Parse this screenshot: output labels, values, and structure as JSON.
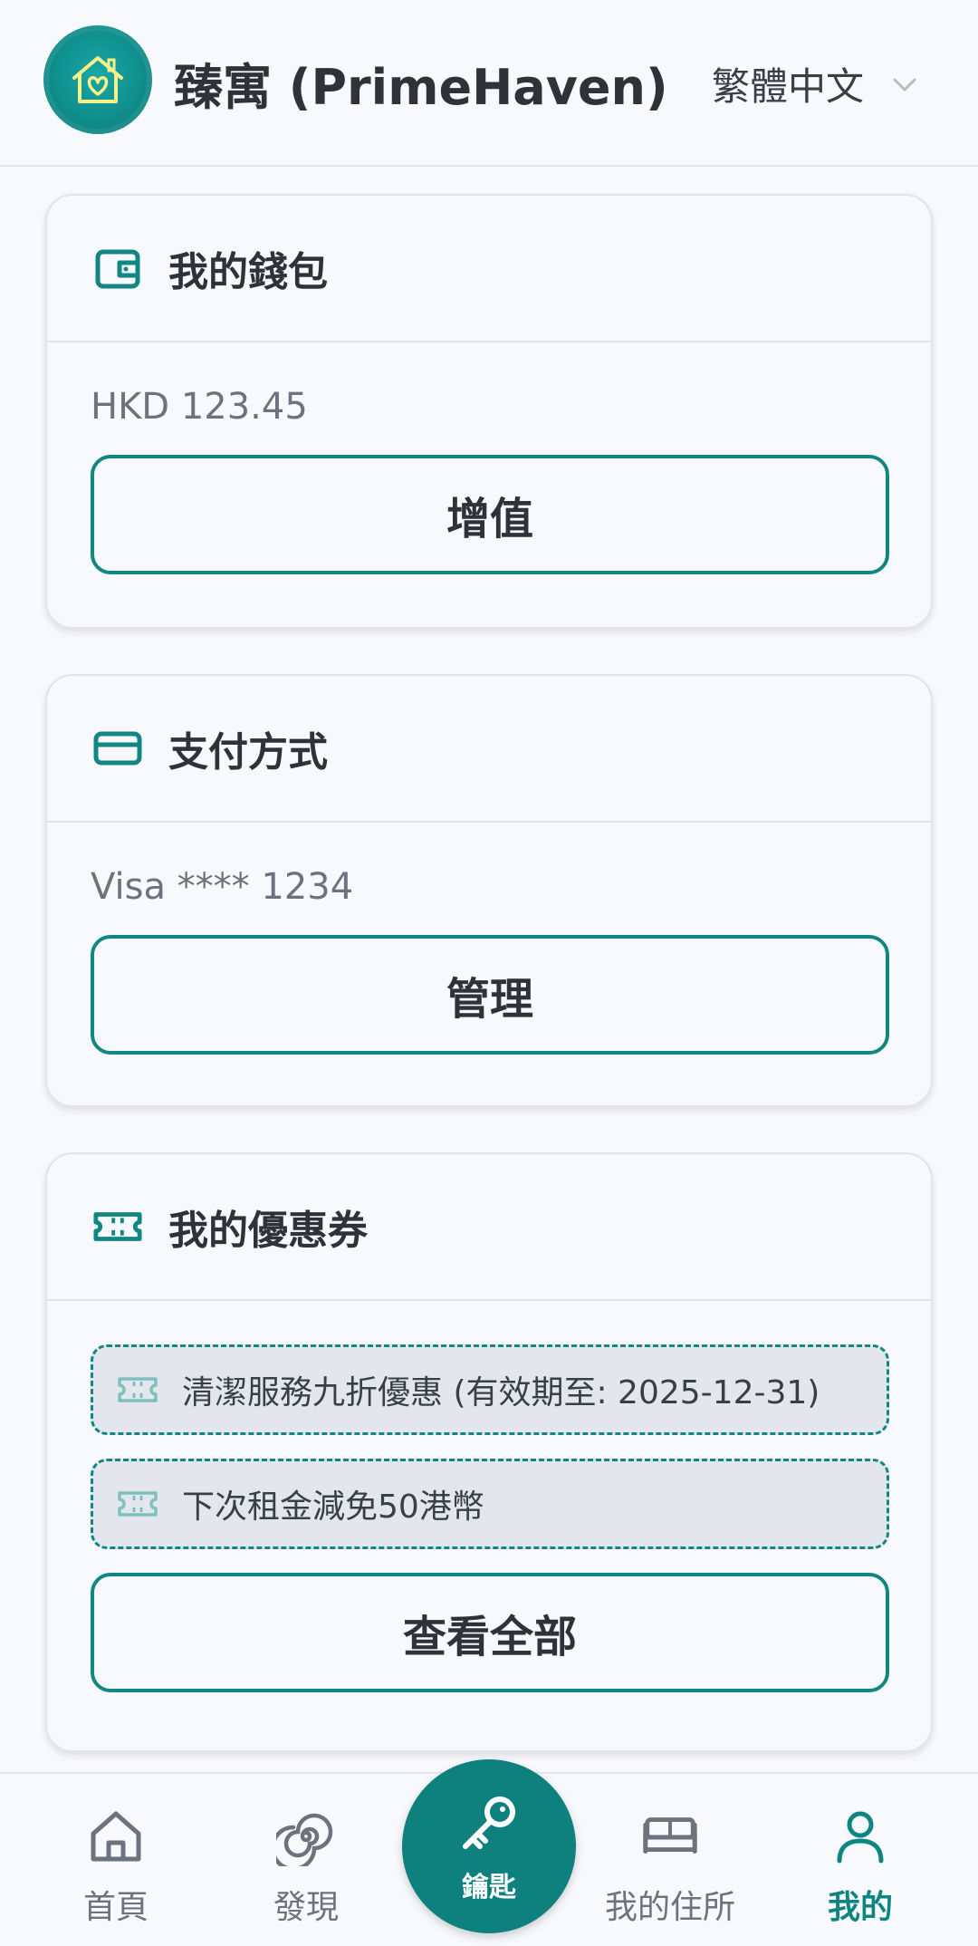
{
  "header": {
    "app_title": "臻寓 (PrimeHaven)",
    "language": "繁體中文",
    "logo_icon": "house-heart-icon"
  },
  "wallet": {
    "title": "我的錢包",
    "balance": "HKD 123.45",
    "button": "增值",
    "icon": "wallet-icon"
  },
  "payment": {
    "title": "支付方式",
    "card": "Visa **** 1234",
    "button": "管理",
    "icon": "credit-card-icon"
  },
  "coupons": {
    "title": "我的優惠券",
    "icon": "ticket-icon",
    "items": [
      {
        "label": "清潔服務九折優惠 (有效期至: 2025-12-31)"
      },
      {
        "label": "下次租金減免50港幣"
      }
    ],
    "button": "查看全部"
  },
  "nav": {
    "items": [
      {
        "label": "首頁",
        "icon": "home-icon"
      },
      {
        "label": "發現",
        "icon": "spiral-icon"
      },
      {
        "label": "鑰匙",
        "icon": "key-icon"
      },
      {
        "label": "我的住所",
        "icon": "bed-icon"
      },
      {
        "label": "我的",
        "icon": "user-icon"
      }
    ],
    "active": "我的"
  },
  "colors": {
    "accent": "#128683",
    "background": "#f8f9fd",
    "text": "#2f3339",
    "muted": "#6c737d"
  }
}
